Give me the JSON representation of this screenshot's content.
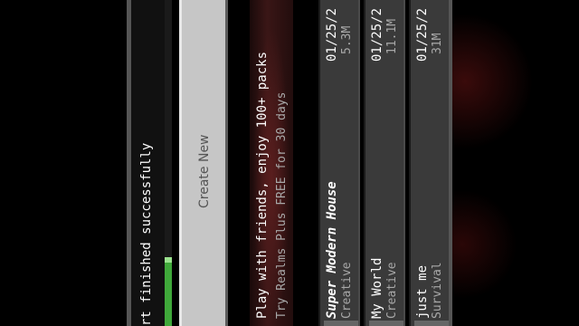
{
  "toast": {
    "message": "rt finished successfully"
  },
  "create_new": {
    "label": "Create New"
  },
  "realms_banner": {
    "title": "Play with friends, enjoy 100+ packs",
    "subtitle": "Try Realms Plus FREE for 30 days"
  },
  "worlds": [
    {
      "name": "Super Modern House",
      "mode": "Creative",
      "date": "01/25/2",
      "size": "5.3M"
    },
    {
      "name": "My World",
      "mode": "Creative",
      "date": "01/25/2",
      "size": "11.1M"
    },
    {
      "name": "just me",
      "mode": "Survival",
      "date": "01/25/2",
      "size": "31M"
    }
  ],
  "colors": {
    "progress_green": "#3fa83a",
    "button_grey": "#c6c6c6",
    "row_grey": "#3a3a3a"
  }
}
